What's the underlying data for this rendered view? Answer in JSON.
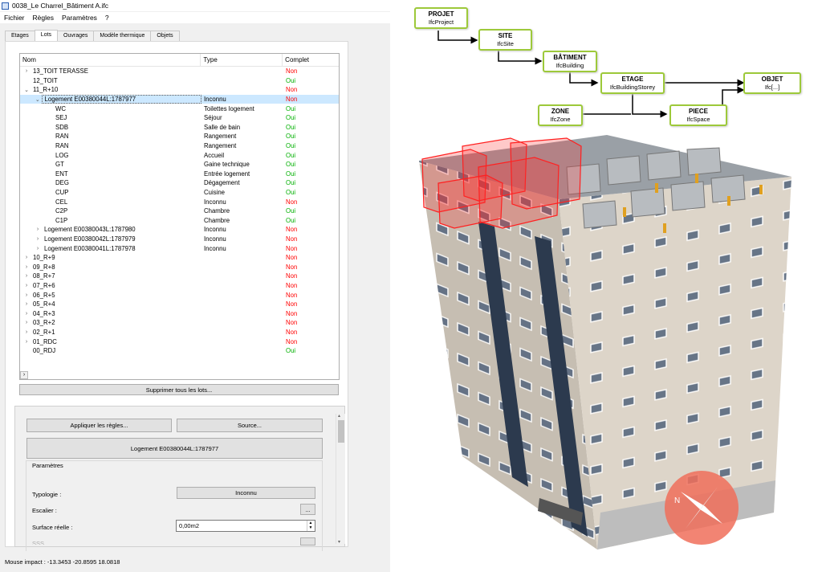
{
  "window": {
    "title": "0038_Le Charrel_Bâtiment A.ifc"
  },
  "menu": [
    "Fichier",
    "Règles",
    "Paramètres",
    "?"
  ],
  "tabs": [
    {
      "label": "Etages",
      "active": false
    },
    {
      "label": "Lots",
      "active": true
    },
    {
      "label": "Ouvrages",
      "active": false
    },
    {
      "label": "Modèle thermique",
      "active": false
    },
    {
      "label": "Objets",
      "active": false
    }
  ],
  "tree": {
    "headers": {
      "nom": "Nom",
      "type": "Type",
      "complet": "Complet"
    },
    "rows": [
      {
        "indent": 0,
        "arrow": "›",
        "nom": "13_TOIT TERASSE",
        "type": "",
        "complet": "Non"
      },
      {
        "indent": 0,
        "arrow": "",
        "nom": "12_TOIT",
        "type": "",
        "complet": "Oui"
      },
      {
        "indent": 0,
        "arrow": "⌄",
        "nom": "11_R+10",
        "type": "",
        "complet": "Non"
      },
      {
        "indent": 1,
        "arrow": "⌄",
        "nom": "Logement E00380044L:1787977",
        "type": "Inconnu",
        "complet": "Non",
        "selected": true
      },
      {
        "indent": 2,
        "arrow": "",
        "nom": "WC",
        "type": "Toilettes logement",
        "complet": "Oui"
      },
      {
        "indent": 2,
        "arrow": "",
        "nom": "SEJ",
        "type": "Séjour",
        "complet": "Oui"
      },
      {
        "indent": 2,
        "arrow": "",
        "nom": "SDB",
        "type": "Salle de bain",
        "complet": "Oui"
      },
      {
        "indent": 2,
        "arrow": "",
        "nom": "RAN",
        "type": "Rangement",
        "complet": "Oui"
      },
      {
        "indent": 2,
        "arrow": "",
        "nom": "RAN",
        "type": "Rangement",
        "complet": "Oui"
      },
      {
        "indent": 2,
        "arrow": "",
        "nom": "LOG",
        "type": "Accueil",
        "complet": "Oui"
      },
      {
        "indent": 2,
        "arrow": "",
        "nom": "GT",
        "type": "Gaine technique",
        "complet": "Oui"
      },
      {
        "indent": 2,
        "arrow": "",
        "nom": "ENT",
        "type": "Entrée logement",
        "complet": "Oui"
      },
      {
        "indent": 2,
        "arrow": "",
        "nom": "DEG",
        "type": "Dégagement",
        "complet": "Oui"
      },
      {
        "indent": 2,
        "arrow": "",
        "nom": "CUP",
        "type": "Cuisine",
        "complet": "Oui"
      },
      {
        "indent": 2,
        "arrow": "",
        "nom": "CEL",
        "type": "Inconnu",
        "complet": "Non"
      },
      {
        "indent": 2,
        "arrow": "",
        "nom": "C2P",
        "type": "Chambre",
        "complet": "Oui"
      },
      {
        "indent": 2,
        "arrow": "",
        "nom": "C1P",
        "type": "Chambre",
        "complet": "Oui"
      },
      {
        "indent": 1,
        "arrow": "›",
        "nom": "Logement E00380043L:1787980",
        "type": "Inconnu",
        "complet": "Non"
      },
      {
        "indent": 1,
        "arrow": "›",
        "nom": "Logement E00380042L:1787979",
        "type": "Inconnu",
        "complet": "Non"
      },
      {
        "indent": 1,
        "arrow": "›",
        "nom": "Logement E00380041L:1787978",
        "type": "Inconnu",
        "complet": "Non"
      },
      {
        "indent": 0,
        "arrow": "›",
        "nom": "10_R+9",
        "type": "",
        "complet": "Non"
      },
      {
        "indent": 0,
        "arrow": "›",
        "nom": "09_R+8",
        "type": "",
        "complet": "Non"
      },
      {
        "indent": 0,
        "arrow": "›",
        "nom": "08_R+7",
        "type": "",
        "complet": "Non"
      },
      {
        "indent": 0,
        "arrow": "›",
        "nom": "07_R+6",
        "type": "",
        "complet": "Non"
      },
      {
        "indent": 0,
        "arrow": "›",
        "nom": "06_R+5",
        "type": "",
        "complet": "Non"
      },
      {
        "indent": 0,
        "arrow": "›",
        "nom": "05_R+4",
        "type": "",
        "complet": "Non"
      },
      {
        "indent": 0,
        "arrow": "›",
        "nom": "04_R+3",
        "type": "",
        "complet": "Non"
      },
      {
        "indent": 0,
        "arrow": "›",
        "nom": "03_R+2",
        "type": "",
        "complet": "Non"
      },
      {
        "indent": 0,
        "arrow": "›",
        "nom": "02_R+1",
        "type": "",
        "complet": "Non"
      },
      {
        "indent": 0,
        "arrow": "›",
        "nom": "01_RDC",
        "type": "",
        "complet": "Non"
      },
      {
        "indent": 0,
        "arrow": "",
        "nom": "00_RDJ",
        "type": "",
        "complet": "Oui"
      }
    ]
  },
  "buttons": {
    "delete_all": "Supprimer tous les lots...",
    "apply_rules": "Appliquer les règles...",
    "source": "Source...",
    "current_lot": "Logement E00380044L:1787977",
    "escalier": "..."
  },
  "params": {
    "title": "Paramètres",
    "typologie_label": "Typologie :",
    "typologie_value": "Inconnu",
    "escalier_label": "Escalier :",
    "surface_label": "Surface réelle :",
    "surface_value": "0,00m2",
    "next_label": "SSS"
  },
  "status": {
    "mouse_impact": "Mouse impact : -13.3453 -20.8595 18.0818"
  },
  "diagram": {
    "boxes": {
      "projet": {
        "title": "PROJET",
        "sub": "IfcProject"
      },
      "site": {
        "title": "SITE",
        "sub": "IfcSite"
      },
      "batiment": {
        "title": "BÂTIMENT",
        "sub": "IfcBuilding"
      },
      "etage": {
        "title": "ETAGE",
        "sub": "IfcBuildingStorey"
      },
      "objet": {
        "title": "OBJET",
        "sub": "Ifc[...]"
      },
      "zone": {
        "title": "ZONE",
        "sub": "IfcZone"
      },
      "piece": {
        "title": "PIECE",
        "sub": "IfcSpace"
      }
    },
    "accent": "#9dc93a"
  },
  "colors": {
    "non": "#ff0000",
    "oui": "#00b000",
    "selection": "#cce8ff",
    "highlight": "#ff2020"
  }
}
